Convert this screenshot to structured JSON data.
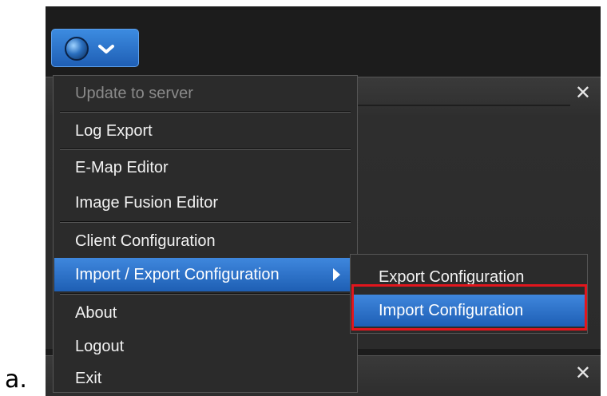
{
  "caption": "a.",
  "menu": {
    "items": [
      {
        "label": "Update to server",
        "state": "disabled"
      },
      {
        "label": "Log Export"
      },
      {
        "label": "E-Map Editor"
      },
      {
        "label": "Image Fusion Editor"
      },
      {
        "label": "Client Configuration"
      },
      {
        "label": "Import / Export Configuration",
        "state": "active",
        "has_submenu": true
      },
      {
        "label": "About"
      },
      {
        "label": "Logout"
      },
      {
        "label": "Exit"
      }
    ]
  },
  "submenu": {
    "items": [
      {
        "label": "Export Configuration"
      },
      {
        "label": "Import Configuration",
        "state": "active",
        "highlighted": true
      }
    ]
  },
  "panels": {
    "close_glyph": "✕"
  },
  "app_button": {
    "icon": "globe-icon",
    "dropdown_icon": "chevron-down-icon",
    "caret": "⌄"
  },
  "colors": {
    "highlight_box": "#e1161d",
    "menu_active": "#2f74c8",
    "app_background": "#1c1c1c"
  }
}
